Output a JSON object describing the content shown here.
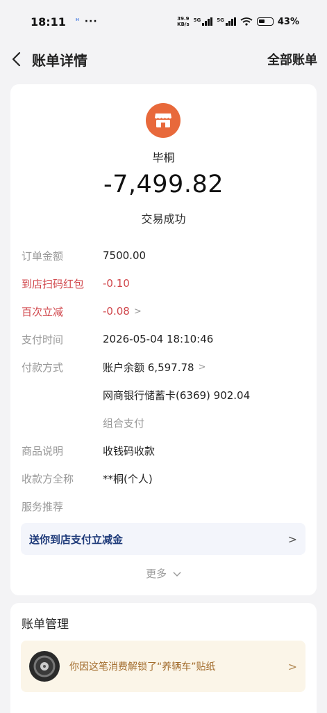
{
  "status_bar": {
    "time": "18:11",
    "indicator": "ᴴ",
    "dots": "···",
    "net_speed_value": "39.9",
    "net_speed_unit": "KB/s",
    "sig1_tag": "5G",
    "sig2_tag": "5G",
    "battery_pct": "43%"
  },
  "header": {
    "title": "账单详情",
    "right_link": "全部账单",
    "back_icon": "chevron-left-icon"
  },
  "bill": {
    "merchant_icon": "store-icon",
    "merchant_color": "#e8693b",
    "merchant_name": "毕桐",
    "amount": "-7,499.82",
    "status": "交易成功",
    "rows": [
      {
        "label": "订单金额",
        "value": "7500.00"
      },
      {
        "label": "到店扫码红包",
        "value": "-0.10"
      },
      {
        "label": "百次立减",
        "value": "-0.08"
      },
      {
        "label": "支付时间",
        "value": "2026-05-04 18:10:46"
      },
      {
        "label": "付款方式",
        "value": "账户余额 6,597.78"
      },
      {
        "label": "",
        "value": "网商银行储蓄卡(6369) 902.04"
      },
      {
        "label": "",
        "value": "组合支付"
      },
      {
        "label": "商品说明",
        "value": "收钱码收款"
      },
      {
        "label": "收款方全称",
        "value": "**桐(个人)"
      },
      {
        "label": "服务推荐",
        "value": ""
      }
    ],
    "promo_text": "送你到店支付立减金",
    "more_label": "更多"
  },
  "manage": {
    "title": "账单管理",
    "sticker_text": "你因这笔消费解锁了“养辆车”贴纸"
  },
  "colors": {
    "red": "#d0464b",
    "promo_text": "#1f3b7a",
    "sticker_text": "#a26b2b"
  }
}
